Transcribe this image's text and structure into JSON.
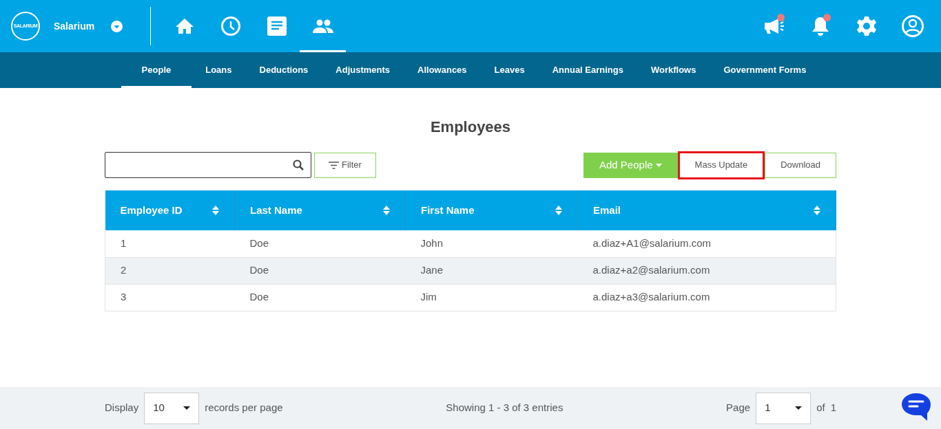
{
  "brand": {
    "name": "Salarium",
    "logo_text": "SALARIUM"
  },
  "top_nav": [
    {
      "kind": "home",
      "selected": false
    },
    {
      "kind": "clock",
      "selected": false
    },
    {
      "kind": "document",
      "selected": false
    },
    {
      "kind": "people",
      "selected": true
    }
  ],
  "top_actions": [
    {
      "kind": "megaphone",
      "badge": true
    },
    {
      "kind": "bell",
      "badge": true
    },
    {
      "kind": "gear",
      "badge": false
    },
    {
      "kind": "user",
      "badge": false
    }
  ],
  "sub_nav": [
    {
      "label": "People",
      "selected": true
    },
    {
      "label": "Loans",
      "selected": false
    },
    {
      "label": "Deductions",
      "selected": false
    },
    {
      "label": "Adjustments",
      "selected": false
    },
    {
      "label": "Allowances",
      "selected": false
    },
    {
      "label": "Leaves",
      "selected": false
    },
    {
      "label": "Annual Earnings",
      "selected": false
    },
    {
      "label": "Workflows",
      "selected": false
    },
    {
      "label": "Government Forms",
      "selected": false
    }
  ],
  "title": "Employees",
  "filter_button": "Filter",
  "buttons": [
    {
      "label": "Add People",
      "kind": "primary",
      "highlighted": false
    },
    {
      "label": "Mass Update",
      "kind": "outline",
      "highlighted": true
    },
    {
      "label": "Download",
      "kind": "outline",
      "highlighted": false
    }
  ],
  "table": {
    "columns": [
      "Employee ID",
      "Last Name",
      "First Name",
      "Email"
    ],
    "rows": [
      [
        "1",
        "Doe",
        "John",
        "a.diaz+A1@salarium.com"
      ],
      [
        "2",
        "Doe",
        "Jane",
        "a.diaz+a2@salarium.com"
      ],
      [
        "3",
        "Doe",
        "Jim",
        "a.diaz+a3@salarium.com"
      ]
    ]
  },
  "footer": {
    "display_label": "Display",
    "page_size": "10",
    "per_page_label": "records per page",
    "showing": "Showing 1 - 3 of 3 entries",
    "page_label": "Page",
    "page": "1",
    "of_label": "of",
    "total_pages": "1"
  }
}
